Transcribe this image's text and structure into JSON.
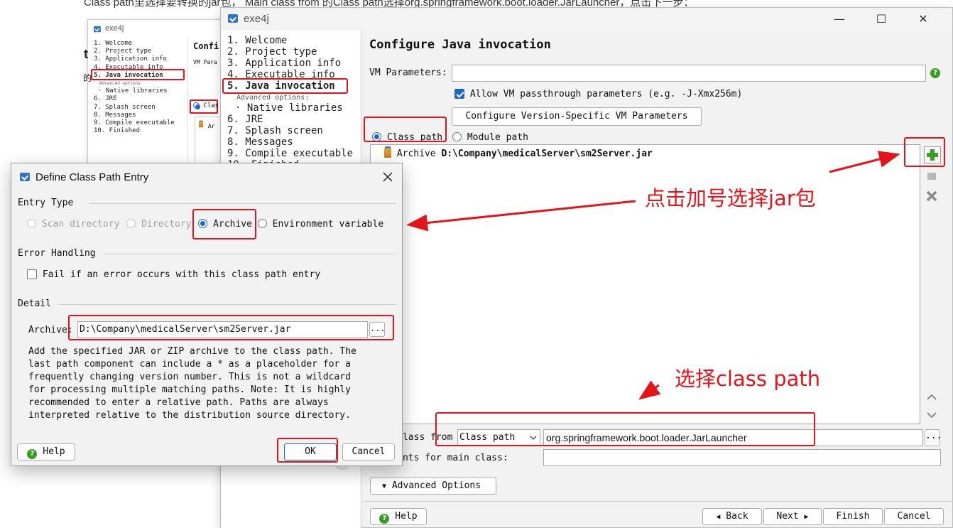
{
  "background": {
    "caption": "Class path里选择要转换的jar包， Main class from 的Class path选择org.springframework.boot.loader.JarLauncher，点击下一步：",
    "small_window": {
      "title": "exe4j",
      "nav": [
        "1. Welcome",
        "2. Project type",
        "3. Application info",
        "4. Executable info",
        "5. Java invocation",
        "Advanced options",
        "· Native libraries",
        "6. JRE",
        "7. Splash screen",
        "8. Messages",
        "9. Compile executable",
        "10. Finished"
      ],
      "heading_fragment": "Confi",
      "vm_fragment": "VM Para",
      "classpath_fragment": "Clas",
      "archive_fragment": "Ar"
    },
    "edge_fragments": [
      "t",
      "的"
    ]
  },
  "main_window": {
    "title": "exe4j",
    "controls": {
      "minimize": "—",
      "maximize": "☐",
      "close": "✕"
    },
    "nav": {
      "items": [
        "1. Welcome",
        "2. Project type",
        "3. Application info",
        "4. Executable info",
        "5. Java invocation",
        "· Native libraries",
        "6. JRE",
        "7. Splash screen",
        "8. Messages",
        "9. Compile executable",
        "10. Finished"
      ],
      "advanced_label": "Advanced options:",
      "watermark": "exe4j"
    },
    "heading": "Configure Java invocation",
    "vm_parameters_label": "VM Parameters:",
    "vm_parameters_value": "",
    "allow_passthrough_label": "Allow VM passthrough parameters (e.g. -J-Xmx256m)",
    "configure_version_button": "Configure Version-Specific VM Parameters",
    "classpath_radio": "Class path",
    "module_path_radio": "Module path",
    "classpath_entries": [
      {
        "type": "Archive",
        "path": "D:\\Company\\medicalServer\\sm2Server.jar"
      }
    ],
    "main_class_label": "Main class from",
    "main_class_source": "Class path",
    "main_class_value": "org.springframework.boot.loader.JarLauncher",
    "arguments_label": "Arguments for main class:",
    "arguments_value": "",
    "advanced_options_button": "Advanced Options",
    "help_button": "Help",
    "back_button": "Back",
    "next_button": "Next",
    "finish_button": "Finish",
    "cancel_button": "Cancel"
  },
  "dialog": {
    "title": "Define Class Path Entry",
    "entry_type_label": "Entry Type",
    "entry_types": [
      "Scan directory",
      "Directory",
      "Archive",
      "Environment variable"
    ],
    "selected_entry_type": "Archive",
    "error_handling_label": "Error Handling",
    "fail_checkbox_label": "Fail if an error occurs with this class path entry",
    "detail_label": "Detail",
    "archive_label": "Archive:",
    "archive_value": "D:\\Company\\medicalServer\\sm2Server.jar",
    "browse_button": "...",
    "description": [
      "Add the specified JAR or ZIP archive to the class path. The",
      "last path component can include a * as a placeholder for a",
      "frequently changing version number. This is not a wildcard",
      "for processing multiple matching paths. Note: It is highly",
      "recommended to enter a relative path. Paths are always",
      "interpreted relative to the distribution source directory."
    ],
    "help_button": "Help",
    "ok_button": "OK",
    "cancel_button": "Cancel"
  },
  "annotations": {
    "click_plus": "点击加号选择jar包",
    "select_classpath": "选择class path"
  },
  "colors": {
    "annotation_red": "#e4141b",
    "accent_blue": "#1e64c8",
    "add_green": "#3a9d23"
  }
}
